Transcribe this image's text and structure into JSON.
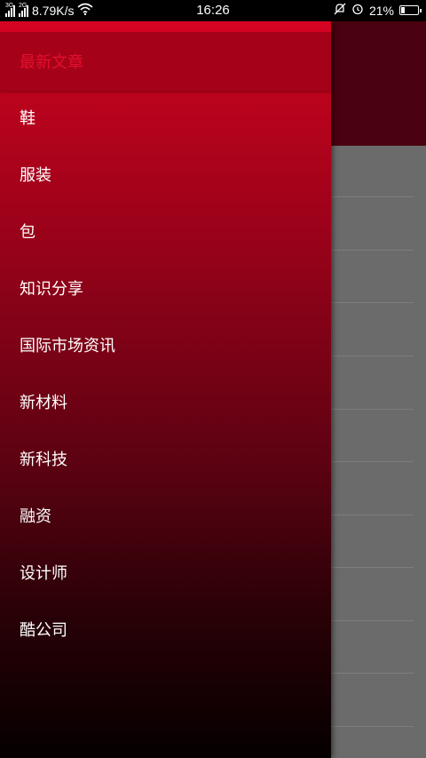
{
  "status_bar": {
    "network_1": "3G",
    "network_2": "2G",
    "speed": "8.79K/s",
    "time": "16:26",
    "battery": "21%",
    "battery_level": 0.21,
    "icons": [
      "signal-icon",
      "signal-icon",
      "wifi-icon",
      "mute-icon",
      "alarm-icon",
      "battery-icon"
    ]
  },
  "drawer": {
    "header": "最新文章",
    "items": [
      "鞋",
      "服装",
      "包",
      "知识分享",
      "国际市场资讯",
      "新材料",
      "新科技",
      "融资",
      "设计师",
      "酷公司"
    ]
  },
  "colors": {
    "drawer_top": "#c9041f",
    "drawer_bottom": "#050000",
    "header_text": "#e4102e",
    "background_toolbar": "#4a0210",
    "background_list": "#6b6b6b"
  }
}
